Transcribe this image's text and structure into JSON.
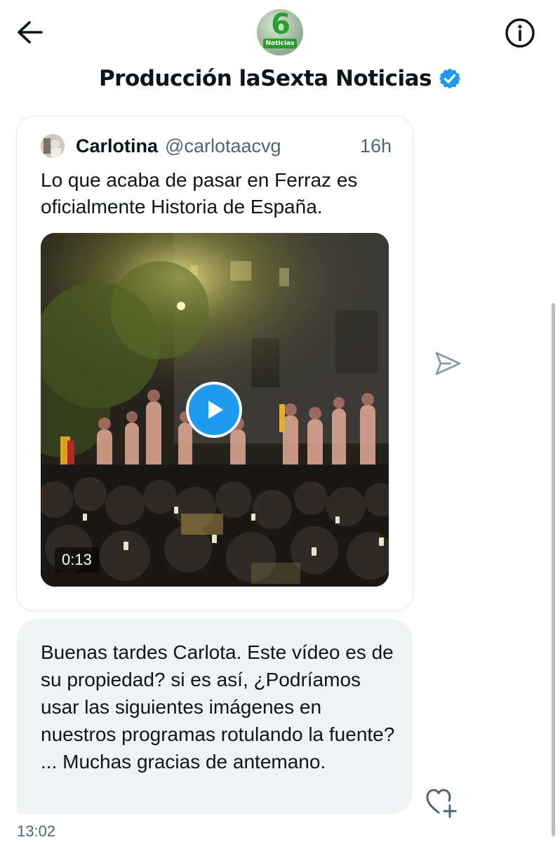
{
  "header": {
    "back_icon": "arrow-left-icon",
    "info_icon": "info-circle-icon",
    "avatar_logo": {
      "digit": "6",
      "word": "Noticias"
    },
    "title": "Producción laSexta Noticias",
    "verified_icon": "verified-badge-icon",
    "verified_color": "#1d9bf0"
  },
  "quoted_tweet": {
    "author_name": "Carlotina",
    "author_handle": "@carlotaacvg",
    "time_ago": "16h",
    "text": "Lo que acaba de pasar en Ferraz es oficialmente Historia de España.",
    "video": {
      "duration": "0:13",
      "play_icon": "play-icon",
      "play_color": "#1d9bf0"
    }
  },
  "send_icon": "send-arrow-icon",
  "message": {
    "text": "Buenas tardes Carlota. Este vídeo es de su propiedad? si es así, ¿Podríamos usar las siguientes imágenes en nuestros programas rotulando la fuente? ... Muchas gracias de antemano.",
    "react_icon": "heart-plus-icon",
    "timestamp": "13:02"
  },
  "colors": {
    "text_primary": "#0f1419",
    "text_secondary": "#536471",
    "bubble_bg": "#eff3f4",
    "accent": "#1d9bf0"
  }
}
